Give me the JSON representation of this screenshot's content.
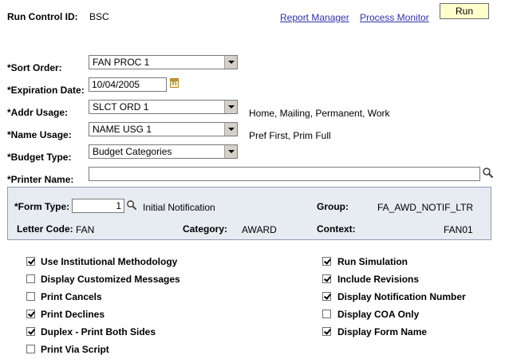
{
  "header": {
    "run_control_label": "Run Control ID:",
    "run_control_value": "BSC",
    "report_manager_link": "Report Manager",
    "process_monitor_link": "Process Monitor",
    "run_button": "Run"
  },
  "form": {
    "sort_order": {
      "label": "*Sort Order:",
      "value": "FAN PROC 1"
    },
    "expiration_date": {
      "label": "*Expiration Date:",
      "value": "10/04/2005"
    },
    "addr_usage": {
      "label": "*Addr Usage:",
      "value": "SLCT ORD 1",
      "description": "Home, Mailing, Permanent, Work"
    },
    "name_usage": {
      "label": "*Name Usage:",
      "value": "NAME USG 1",
      "description": "Pref First, Prim Full"
    },
    "budget_type": {
      "label": "*Budget Type:",
      "value": "Budget Categories"
    },
    "printer_name": {
      "label": "*Printer Name:",
      "value": ""
    }
  },
  "panel": {
    "form_type_label": "*Form Type:",
    "form_type_value": "1",
    "form_type_description": "Initial Notification",
    "group_label": "Group:",
    "group_value": "FA_AWD_NOTIF_LTR",
    "letter_code_label": "Letter Code:",
    "letter_code_value": "FAN",
    "category_label": "Category:",
    "category_value": "AWARD",
    "context_label": "Context:",
    "context_value": "FAN01"
  },
  "options_left": [
    {
      "label": "Use Institutional Methodology",
      "checked": true
    },
    {
      "label": "Display Customized Messages",
      "checked": false
    },
    {
      "label": "Print Cancels",
      "checked": false
    },
    {
      "label": "Print Declines",
      "checked": true
    },
    {
      "label": "Duplex - Print Both Sides",
      "checked": true
    },
    {
      "label": "Print Via Script",
      "checked": false
    }
  ],
  "options_right": [
    {
      "label": "Run Simulation",
      "checked": true
    },
    {
      "label": "Include Revisions",
      "checked": true
    },
    {
      "label": "Display Notification Number",
      "checked": true
    },
    {
      "label": "Display COA Only",
      "checked": false
    },
    {
      "label": "Display Form Name",
      "checked": true
    }
  ],
  "colors": {
    "link": "#2b34a8",
    "run_button_bg": "#ffffcc",
    "panel_bg": "#e7ebf2",
    "panel_border": "#8e9bb0"
  },
  "icons": {
    "calendar": "calendar-icon",
    "lookup": "magnifier-icon",
    "dropdown": "chevron-down-icon"
  }
}
